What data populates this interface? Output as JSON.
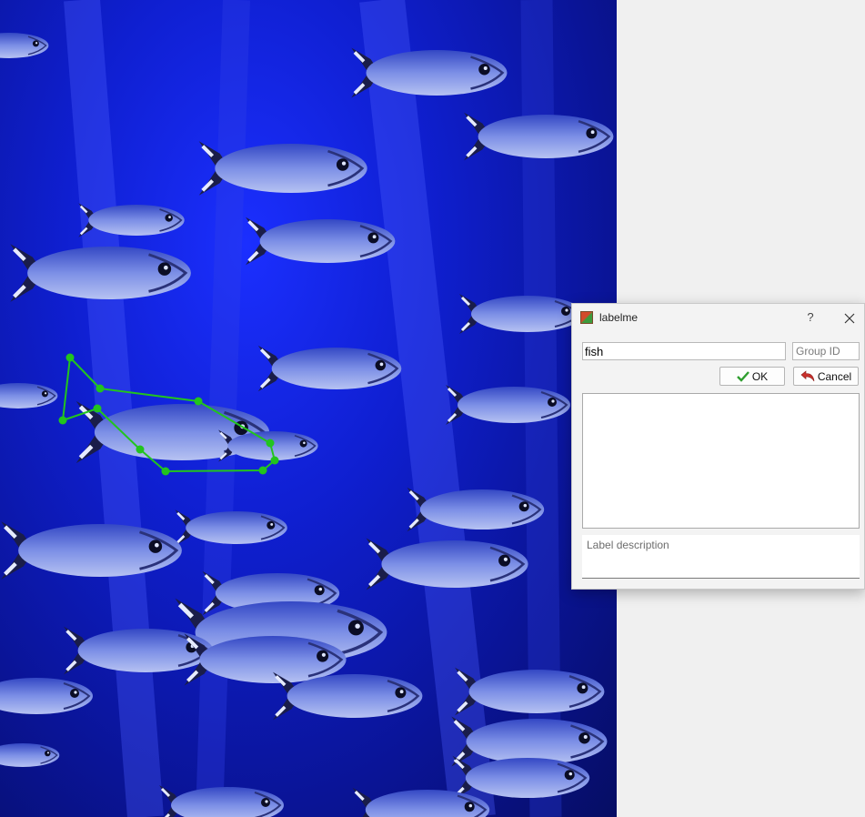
{
  "dialog": {
    "title": "labelme",
    "help_label": "?",
    "label_value": "fish",
    "group_id_placeholder": "Group ID",
    "ok_label": "OK",
    "cancel_label": "Cancel",
    "description_placeholder": "Label description"
  },
  "icons": {
    "app": "labelme-app-icon",
    "help": "question-mark-icon",
    "close": "close-icon",
    "ok": "checkmark-icon",
    "cancel": "undo-arrow-icon"
  },
  "colors": {
    "polygon": "#22c41e",
    "water_dark": "#060d63",
    "water_light": "#1b2fff",
    "fish_body": "#5a6fd6",
    "fish_belly": "#a9b6ee"
  }
}
